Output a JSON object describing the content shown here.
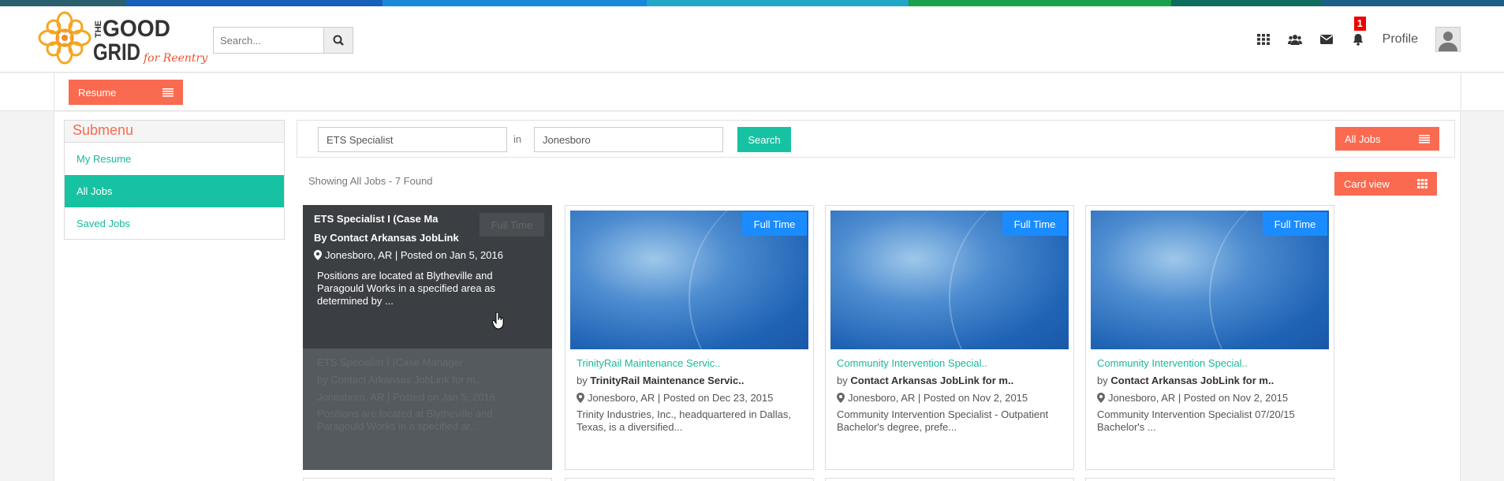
{
  "colors": {
    "accent_orange": "#fa6a50",
    "accent_teal": "#17c2a2",
    "tag_blue": "#1a8cff",
    "colorbar": [
      "#2a5f6e",
      "#1560b8",
      "#1a88d8",
      "#21a6c8",
      "#1aa04a",
      "#0e6e5e",
      "#1b5e8a"
    ]
  },
  "logo": {
    "line1": "THE",
    "word1": "GOOD",
    "word2": "GRID",
    "tagline": "for Reentry"
  },
  "header": {
    "search_placeholder": "Search...",
    "icons": [
      "apps-grid-icon",
      "users-icon",
      "envelope-icon",
      "bell-icon"
    ],
    "notification_count": "1",
    "profile_label": "Profile"
  },
  "subbar": {
    "resume_label": "Resume"
  },
  "submenu": {
    "title": "Submenu",
    "items": [
      {
        "label": "My Resume",
        "active": false
      },
      {
        "label": "All Jobs",
        "active": true
      },
      {
        "label": "Saved Jobs",
        "active": false
      }
    ]
  },
  "filter": {
    "keyword_value": "ETS Specialist",
    "in_label": "in",
    "location_value": "Jonesboro",
    "search_label": "Search",
    "all_jobs_label": "All Jobs"
  },
  "results": {
    "showing": "Showing All Jobs - 7 Found",
    "card_view_label": "Card view"
  },
  "hover_card": {
    "title": "ETS Specialist I (Case Ma",
    "by": "By Contact Arkansas JobLink",
    "location": "Jonesboro, AR | Posted on Jan 5, 2016",
    "description": "Positions are located at Blytheville and Paragould Works in a specified area as determined by ...",
    "tag": "Full Time",
    "faded_title": "ETS Specialist I (Case Manager",
    "faded_by": "by Contact Arkansas JobLink for m..",
    "faded_location": "Jonesboro, AR | Posted on Jan 5, 2016",
    "faded_desc": "Positions are located at Blytheville and Paragould Works in a specified ar..."
  },
  "cards": [
    {
      "tag": "Full Time",
      "title": "TrinityRail Maintenance Servic..",
      "by_prefix": "by",
      "company": "TrinityRail Maintenance Servic..",
      "location": "Jonesboro, AR | Posted on Dec 23, 2015",
      "description": "Trinity Industries, Inc., headquartered in Dallas, Texas, is a diversified..."
    },
    {
      "tag": "Full Time",
      "title": "Community Intervention Special..",
      "by_prefix": "by",
      "company": "Contact Arkansas JobLink for m..",
      "location": "Jonesboro, AR | Posted on Nov 2, 2015",
      "description": "Community Intervention Specialist - Outpatient Bachelor's degree, prefe..."
    },
    {
      "tag": "Full Time",
      "title": "Community Intervention Special..",
      "by_prefix": "by",
      "company": "Contact Arkansas JobLink for m..",
      "location": "Jonesboro, AR | Posted on Nov 2, 2015",
      "description": "Community Intervention Specialist 07/20/15 Bachelor's ..."
    }
  ]
}
